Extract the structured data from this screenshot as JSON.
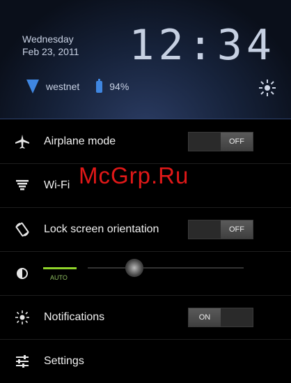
{
  "header": {
    "day": "Wednesday",
    "date": "Feb 23, 2011",
    "clock": "12:34",
    "network": "westnet",
    "battery": "94%"
  },
  "rows": {
    "airplane": {
      "label": "Airplane mode",
      "toggle": "OFF"
    },
    "wifi": {
      "label": "Wi-Fi"
    },
    "lock": {
      "label": "Lock screen orientation",
      "toggle": "OFF"
    },
    "brightness": {
      "auto_label": "AUTO",
      "level": 0.3
    },
    "notifications": {
      "label": "Notifications",
      "toggle": "ON"
    },
    "settings": {
      "label": "Settings"
    }
  },
  "watermark": "McGrp.Ru",
  "colors": {
    "accent": "#3f86e0",
    "auto": "#8fd42a",
    "watermark": "#e01818"
  }
}
